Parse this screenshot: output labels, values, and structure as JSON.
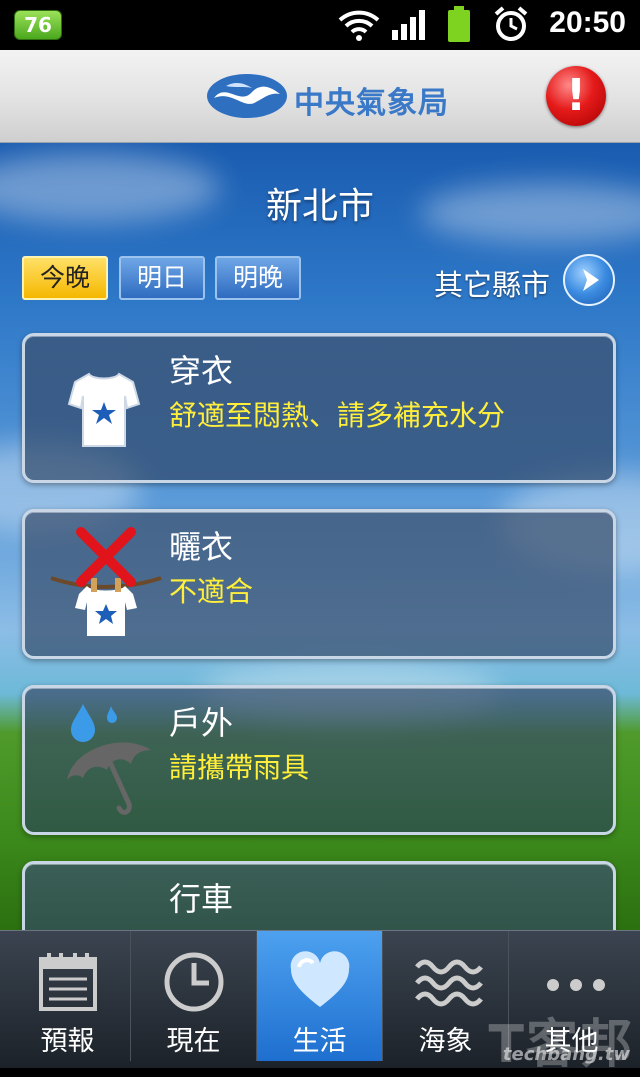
{
  "status_bar": {
    "notification_count": "76",
    "time": "20:50",
    "icons": [
      "wifi-icon",
      "signal-icon",
      "battery-icon",
      "alarm-icon"
    ]
  },
  "header": {
    "agency_name": "中央氣象局",
    "alert_symbol": "!"
  },
  "main": {
    "city": "新北市",
    "day_tabs": [
      {
        "label": "今晚",
        "active": true
      },
      {
        "label": "明日",
        "active": false
      },
      {
        "label": "明晚",
        "active": false
      }
    ],
    "other_cities_label": "其它縣市",
    "cards": [
      {
        "title": "穿衣",
        "description": "舒適至悶熱、請多補充水分",
        "icon": "tshirt-icon"
      },
      {
        "title": "曬衣",
        "description": "不適合",
        "icon": "laundry-not-suitable-icon"
      },
      {
        "title": "戶外",
        "description": "請攜帶雨具",
        "icon": "umbrella-rain-icon"
      },
      {
        "title": "行車",
        "description": "",
        "icon": ""
      }
    ]
  },
  "bottom_nav": [
    {
      "label": "預報",
      "icon": "calendar-icon",
      "active": false
    },
    {
      "label": "現在",
      "icon": "clock-icon",
      "active": false
    },
    {
      "label": "生活",
      "icon": "heart-icon",
      "active": true
    },
    {
      "label": "海象",
      "icon": "waves-icon",
      "active": false
    },
    {
      "label": "其他",
      "icon": "more-icon",
      "active": false
    }
  ],
  "watermark": {
    "text": "T客邦",
    "url_text": "techbang.tw"
  },
  "colors": {
    "accent_yellow": "#ffee3a",
    "active_tab": "#f5b700",
    "nav_active": "#1e6fcf"
  }
}
